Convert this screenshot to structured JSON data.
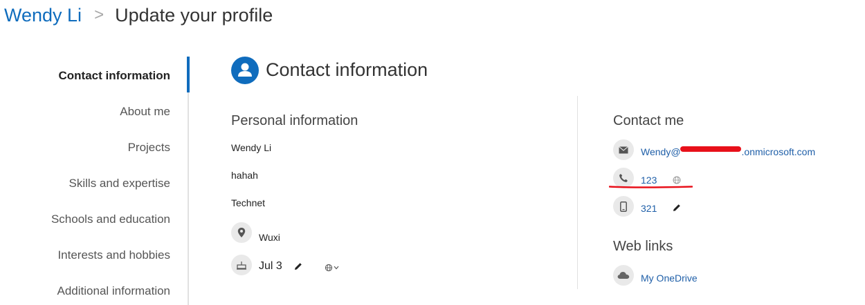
{
  "breadcrumb": {
    "user": "Wendy Li",
    "separator": ">",
    "page": "Update your profile"
  },
  "nav": {
    "items": [
      {
        "label": "Contact information",
        "active": true
      },
      {
        "label": "About me"
      },
      {
        "label": "Projects"
      },
      {
        "label": "Skills and expertise"
      },
      {
        "label": "Schools and education"
      },
      {
        "label": "Interests and hobbies"
      },
      {
        "label": "Additional information"
      }
    ]
  },
  "section": {
    "title": "Contact information",
    "icon": "person-icon"
  },
  "personal": {
    "title": "Personal information",
    "name": "Wendy Li",
    "line2": "hahah",
    "line3": "Technet",
    "location": "Wuxi",
    "birthday": "Jul 3",
    "birthday_visibility_icon": "globe-chevron-icon"
  },
  "contact": {
    "title": "Contact me",
    "email_prefix": "Wendy@",
    "email_suffix": ".onmicrosoft.com",
    "work_phone": "123",
    "mobile_phone": "321"
  },
  "weblinks": {
    "title": "Web links",
    "onedrive": "My OneDrive"
  },
  "colors": {
    "accent": "#0f6cbd",
    "link": "#1f5fa8",
    "annotation_red": "#e8101a"
  }
}
